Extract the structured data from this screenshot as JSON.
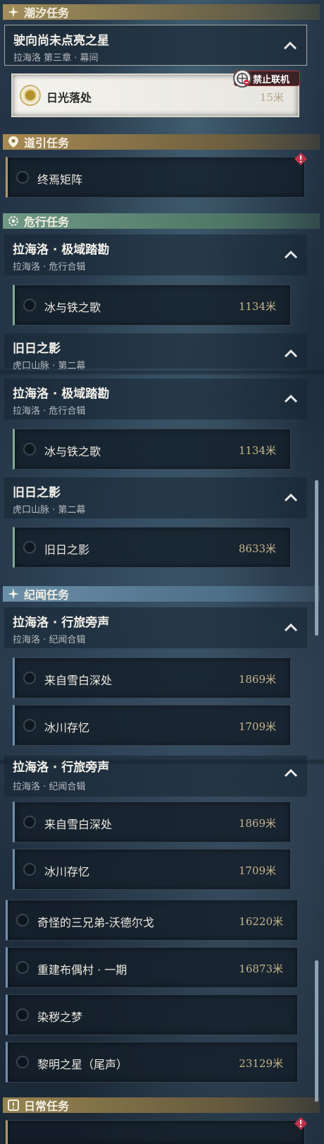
{
  "categories": {
    "tide": "潮汐任务",
    "guide": "道引任务",
    "danger": "危行任务",
    "story": "纪闻任务",
    "daily": "日常任务"
  },
  "tide_group": {
    "title": "驶向尚未点亮之星",
    "subtitle": "拉海洛 第三章 · 幕间"
  },
  "tide_task": {
    "name": "日光落处",
    "distance": "15米",
    "badge": "禁止联机"
  },
  "guide_task": {
    "name": "终焉矩阵"
  },
  "danger": {
    "group1": {
      "title": "拉海洛 · 极域踏勘",
      "subtitle": "拉海洛 · 危行合辑"
    },
    "task1": {
      "name": "冰与铁之歌",
      "distance": "1134米"
    },
    "group2": {
      "title": "旧日之影",
      "subtitle": "虎口山脉 · 第二幕"
    },
    "group3": {
      "title": "拉海洛 · 极域踏勘",
      "subtitle": "拉海洛 · 危行合辑"
    },
    "task3": {
      "name": "冰与铁之歌",
      "distance": "1134米"
    },
    "group4": {
      "title": "旧日之影",
      "subtitle": "虎口山脉 · 第二幕"
    },
    "task4": {
      "name": "旧日之影",
      "distance": "8633米"
    }
  },
  "story": {
    "group1": {
      "title": "拉海洛 · 行旅旁声",
      "subtitle": "拉海洛 · 纪闻合辑"
    },
    "task1": {
      "name": "来自雪白深处",
      "distance": "1869米"
    },
    "task2": {
      "name": "冰川存忆",
      "distance": "1709米"
    },
    "group2": {
      "title": "拉海洛 · 行旅旁声",
      "subtitle": "拉海洛 · 纪闻合辑"
    },
    "task3": {
      "name": "来自雪白深处",
      "distance": "1869米"
    },
    "task4": {
      "name": "冰川存忆",
      "distance": "1709米"
    },
    "task5": {
      "name": "奇怪的三兄弟-沃德尔戈",
      "distance": "16220米"
    },
    "task6": {
      "name": "重建布偶村 · 一期",
      "distance": "16873米"
    },
    "task7": {
      "name": "染秽之梦"
    },
    "task8": {
      "name": "黎明之星（尾声）",
      "distance": "23129米"
    }
  },
  "colors": {
    "accent_gold": "#c9b58a",
    "danger_green": "#7fae8e",
    "story_blue": "#7190ad",
    "warning_red": "#c2334a"
  }
}
